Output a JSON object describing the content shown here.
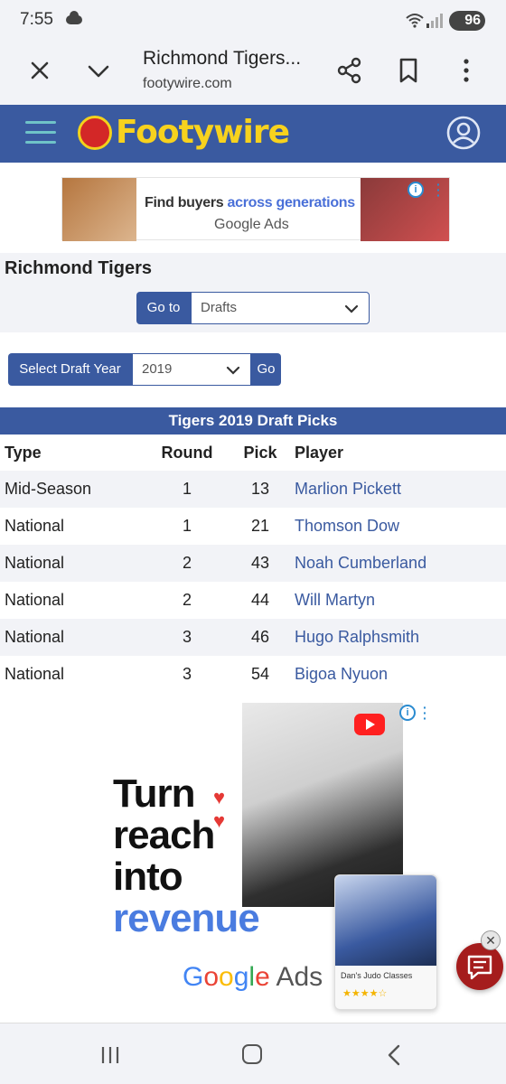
{
  "status_bar": {
    "time": "7:55",
    "battery": "96"
  },
  "browser": {
    "tab_title": "Richmond Tigers...",
    "url": "footywire.com"
  },
  "site": {
    "logo_text": "Footywire"
  },
  "top_ad": {
    "headline_part1": "Find buyers ",
    "headline_part2": "across generations",
    "brand": "Google Ads"
  },
  "team": {
    "title": "Richmond Tigers",
    "goto_label": "Go to",
    "goto_value": "Drafts"
  },
  "draft": {
    "label": "Select Draft Year",
    "year": "2019",
    "go_label": "Go"
  },
  "table": {
    "caption": "Tigers 2019 Draft Picks",
    "headers": {
      "type": "Type",
      "round": "Round",
      "pick": "Pick",
      "player": "Player"
    },
    "rows": [
      {
        "type": "Mid-Season",
        "round": "1",
        "pick": "13",
        "player": "Marlion Pickett"
      },
      {
        "type": "National",
        "round": "1",
        "pick": "21",
        "player": "Thomson Dow"
      },
      {
        "type": "National",
        "round": "2",
        "pick": "43",
        "player": "Noah Cumberland"
      },
      {
        "type": "National",
        "round": "2",
        "pick": "44",
        "player": "Will Martyn"
      },
      {
        "type": "National",
        "round": "3",
        "pick": "46",
        "player": "Hugo Ralphsmith"
      },
      {
        "type": "National",
        "round": "3",
        "pick": "54",
        "player": "Bigoa Nyuon"
      }
    ]
  },
  "big_ad": {
    "line1": "Turn",
    "line2": "reach",
    "line3": "into",
    "line4": "revenue",
    "card_label": "Dan's Judo Classes",
    "card_stars": "★★★★☆",
    "brand_G": "G",
    "brand_o1": "o",
    "brand_o2": "o",
    "brand_g": "g",
    "brand_l": "l",
    "brand_e": "e",
    "brand_suffix": " Ads"
  },
  "colors": {
    "brand_blue": "#3a5aa0",
    "logo_yellow": "#f7d21e",
    "link_blue": "#3a5aa0",
    "fab_red": "#a51d1d"
  }
}
